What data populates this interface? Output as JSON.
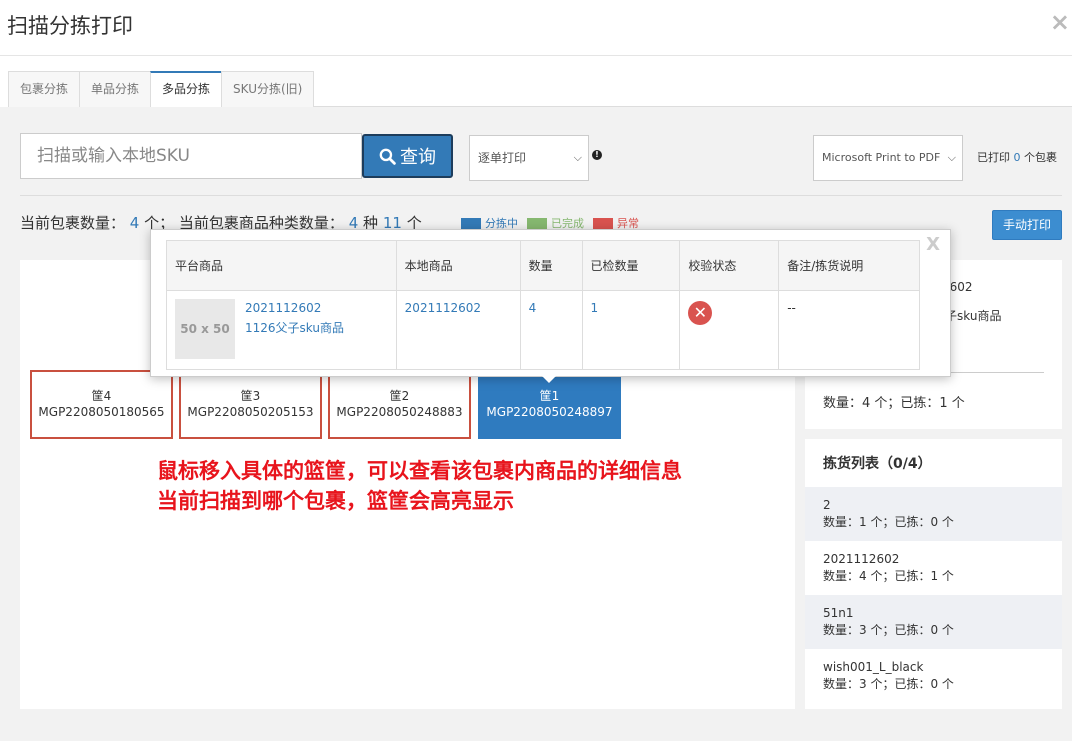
{
  "modal": {
    "title": "扫描分拣打印",
    "close_label": "×"
  },
  "tabs": [
    {
      "label": "包裹分拣",
      "active": false
    },
    {
      "label": "单品分拣",
      "active": false
    },
    {
      "label": "多品分拣",
      "active": true
    },
    {
      "label": "SKU分拣(旧)",
      "active": false
    }
  ],
  "search": {
    "placeholder": "扫描或输入本地SKU",
    "button_label": "查询"
  },
  "print_mode": {
    "selected": "逐单打印"
  },
  "printer": {
    "selected": "Microsoft Print to PDF"
  },
  "printed": {
    "prefix": "已打印",
    "count": "0",
    "suffix": "个包裹"
  },
  "stats": {
    "label_count": "当前包裹数量：",
    "package_count": "4",
    "unit_ge": "个；",
    "label_kinds": "当前包裹商品种类数量：",
    "kind_count": "4",
    "unit_zhong": "种",
    "item_count": "11",
    "unit_ge2": "个"
  },
  "legend": [
    {
      "label": "分拣中",
      "color": "#337ab7"
    },
    {
      "label": "已完成",
      "color": "#86b870"
    },
    {
      "label": "异常",
      "color": "#d9534f"
    }
  ],
  "manual_print_label": "手动打印",
  "baskets": [
    {
      "name": "筐4",
      "code": "MGP2208050180565",
      "active": false
    },
    {
      "name": "筐3",
      "code": "MGP2208050205153",
      "active": false
    },
    {
      "name": "筐2",
      "code": "MGP2208050248883",
      "active": false
    },
    {
      "name": "筐1",
      "code": "MGP2208050248897",
      "active": true
    }
  ],
  "annotation": {
    "line1": "鼠标移入具体的篮筐，可以查看该包裹内商品的详细信息",
    "line2": "当前扫描到哪个包裹，篮筐会高亮显示"
  },
  "side_panel": {
    "partial_sku": "2602",
    "partial_name": "子sku商品",
    "summary": "数量：4 个；已拣：1 个",
    "picklist_title": "拣货列表（0/4）",
    "items": [
      {
        "sku": "2",
        "detail": "数量：1 个；已拣：0 个"
      },
      {
        "sku": "2021112602",
        "detail": "数量：4 个；已拣：1 个"
      },
      {
        "sku": "51n1",
        "detail": "数量：3 个；已拣：0 个"
      },
      {
        "sku": "wish001_L_black",
        "detail": "数量：3 个；已拣：0 个"
      }
    ]
  },
  "popup": {
    "close_label": "X",
    "headers": [
      "平台商品",
      "本地商品",
      "数量",
      "已检数量",
      "校验状态",
      "备注/拣货说明"
    ],
    "row": {
      "thumb": "50 x 50",
      "platform_sku": "2021112602",
      "platform_name": "1126父子sku商品",
      "local_sku": "2021112602",
      "qty": "4",
      "checked": "1",
      "status_icon": "error-icon",
      "note": "--"
    }
  }
}
